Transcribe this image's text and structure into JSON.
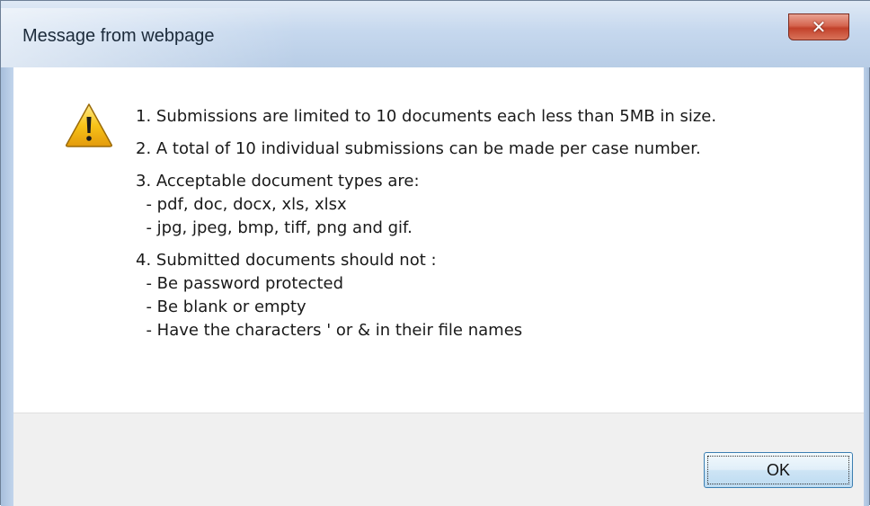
{
  "dialog": {
    "title": "Message from webpage",
    "close_glyph": "✕",
    "icon": "warning-icon",
    "ok_label": "OK"
  },
  "message": {
    "items": [
      {
        "lines": [
          "1. Submissions are limited to 10 documents each less than 5MB in size."
        ]
      },
      {
        "lines": [
          "2. A total of 10 individual submissions can be made per case number."
        ]
      },
      {
        "lines": [
          "3. Acceptable document types are:",
          "  - pdf, doc, docx, xls, xlsx",
          "  - jpg, jpeg, bmp, tiff, png and gif."
        ]
      },
      {
        "lines": [
          "4. Submitted documents should not :",
          "  - Be password protected",
          "  - Be blank or empty",
          "  - Have the characters ' or & in their file names"
        ]
      }
    ]
  },
  "colors": {
    "close_button": "#c2412a",
    "warning_yellow": "#f7c318",
    "ok_border": "#3c7fb1"
  }
}
